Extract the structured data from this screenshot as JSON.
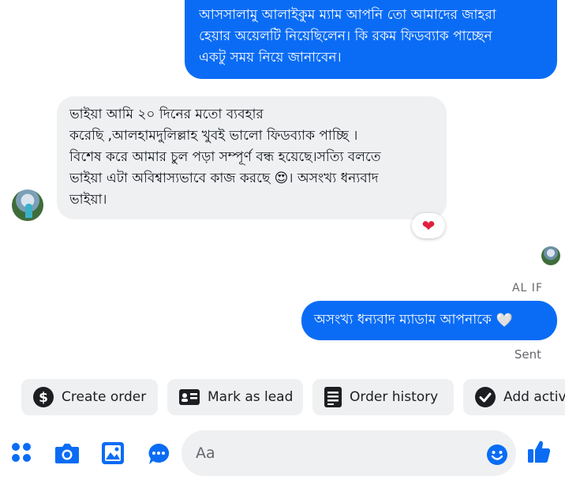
{
  "messages": {
    "outgoing_1": {
      "lines": [
        "আসসালামু আলাইকুম ম্যাম আপনি তো আমাদের জাহরা",
        "হেয়ার অয়েলটি নিয়েছিলেন। কি রকম ফিডব্যাক পাচ্ছেন",
        "একটু সময় নিয়ে জানাবেন।"
      ]
    },
    "incoming_1": {
      "lines": [
        "ভাইয়া আমি ২০ দিনের মতো ব্যবহার",
        "করেছি ,আলহামদুলিল্লাহ খুবই ভালো ফিডব্যাক পাচ্ছি ।",
        "বিশেষ করে আমার চুল পড়া সম্পূর্ণ বন্ধ হয়েছে।সত্যি বলতে",
        "ভাইয়া এটা অবিশ্বাস্যভাবে কাজ করছে 😍। অসংখ্য ধন্যবাদ",
        "ভাইয়া।"
      ],
      "reaction": "❤"
    },
    "seen_label": "AL IF",
    "outgoing_2": {
      "text": "অসংখ্য ধন্যবাদ ম্যাডাম আপনাকে",
      "emoji": "🤍"
    },
    "status": "Sent"
  },
  "quick_actions": [
    {
      "label": "Create order",
      "icon": "dollar-icon"
    },
    {
      "label": "Mark as lead",
      "icon": "id-card-icon"
    },
    {
      "label": "Order history",
      "icon": "document-list-icon"
    },
    {
      "label": "Add activ",
      "icon": "checkmark-circle-icon"
    }
  ],
  "composer": {
    "placeholder": "Aa",
    "icons": [
      "menu-dots-icon",
      "camera-icon",
      "gallery-icon",
      "chat-bubble-icon",
      "emoji-icon",
      "thumbs-up-icon"
    ]
  },
  "colors": {
    "accent": "#0A6CF5",
    "bubble_gray": "#EFF0F2",
    "muted_text": "#65676B"
  }
}
